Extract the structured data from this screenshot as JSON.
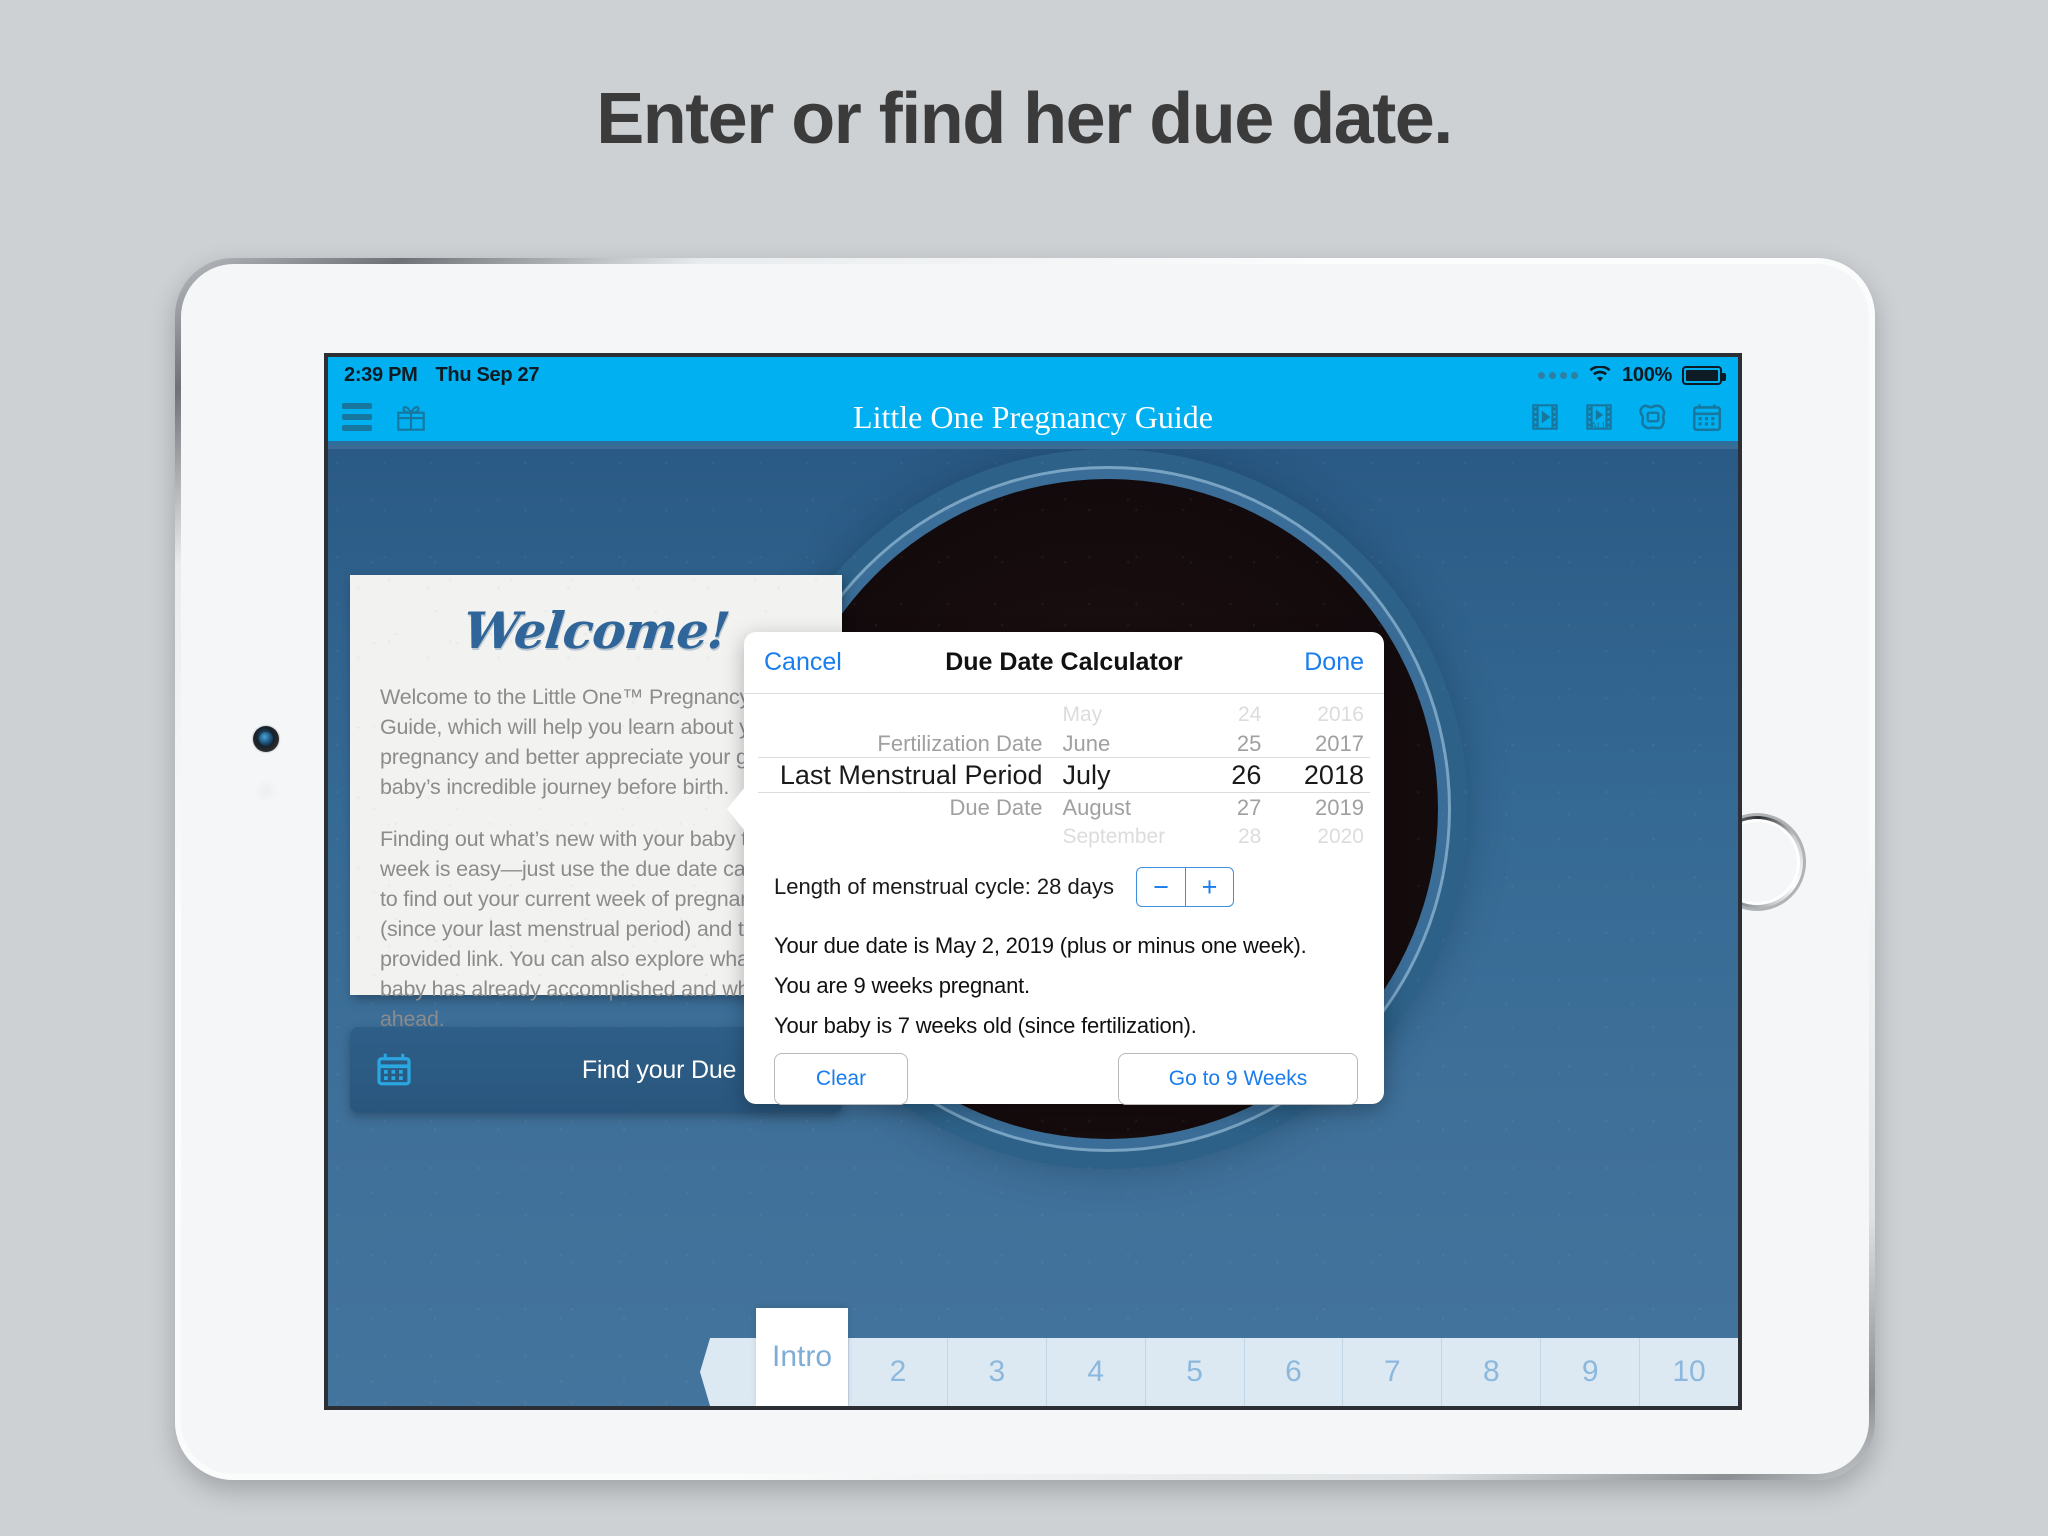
{
  "headline": "Enter or find her due date.",
  "device": {
    "camera_icon": "front-camera",
    "home_button": "home-button"
  },
  "statusbar": {
    "time": "2:39 PM",
    "date": "Thu Sep 27",
    "wifi_icon": "wifi-icon",
    "battery_percent": "100%",
    "battery_icon": "battery-full-icon"
  },
  "navbar": {
    "menu_icon": "hamburger-menu-icon",
    "gift_icon": "gift-icon",
    "title": "Little One Pregnancy Guide",
    "right_icons": [
      {
        "name": "film-play-icon",
        "label": ""
      },
      {
        "name": "film-play-all-icon",
        "label": "ALL"
      },
      {
        "name": "frame-icon",
        "label": ""
      },
      {
        "name": "calendar-icon",
        "label": ""
      }
    ]
  },
  "welcome_card": {
    "title": "Welcome!",
    "paragraph1": "Welcome to the Little One™ Pregnancy Guide, which will help you learn about your pregnancy and better appreciate your growing baby’s incredible journey before birth.",
    "paragraph2": "Finding out what’s new with your baby this week is easy—just use the due date calculator to find out your current week of pregnancy (since your last menstrual period) and tap the provided link. You can also explore what your baby has already accomplished and what lies ahead."
  },
  "find_due_date_button": {
    "label": "Find your Due Date",
    "icon": "calendar-icon",
    "chevron": "›"
  },
  "popover": {
    "cancel_label": "Cancel",
    "title": "Due Date Calculator",
    "done_label": "Done",
    "picker": {
      "mode_column": {
        "items": [
          "Fertilization Date",
          "Last Menstrual Period",
          "Due Date"
        ],
        "selected": "Last Menstrual Period"
      },
      "month_column": {
        "items": [
          "May",
          "June",
          "July",
          "August",
          "September"
        ],
        "selected": "July"
      },
      "day_column": {
        "items": [
          "24",
          "25",
          "26",
          "27",
          "28"
        ],
        "selected": "26"
      },
      "year_column": {
        "items": [
          "2016",
          "2017",
          "2018",
          "2019",
          "2020"
        ],
        "selected": "2018"
      }
    },
    "cycle": {
      "label": "Length of menstrual cycle:  28 days",
      "minus_label": "−",
      "plus_label": "+"
    },
    "results": [
      "Your due date is May 2, 2019 (plus or minus one week).",
      "You are 9 weeks pregnant.",
      "Your baby is 7 weeks old (since fertilization)."
    ],
    "clear_label": "Clear",
    "goto_label": "Go to 9 Weeks"
  },
  "tabbar": {
    "back_arrow": "left-arrow-tab",
    "intro_label": "Intro",
    "weeks": [
      "2",
      "3",
      "4",
      "5",
      "6",
      "7",
      "8",
      "9",
      "10"
    ]
  },
  "colors": {
    "page_bg": "#cdd1d4",
    "accent_blue": "#00b0f0",
    "link_blue": "#1a7ded",
    "screen_blue": "#3a6c96",
    "tab_blue": "#dde9f2",
    "headline": "#3b3b3b"
  }
}
